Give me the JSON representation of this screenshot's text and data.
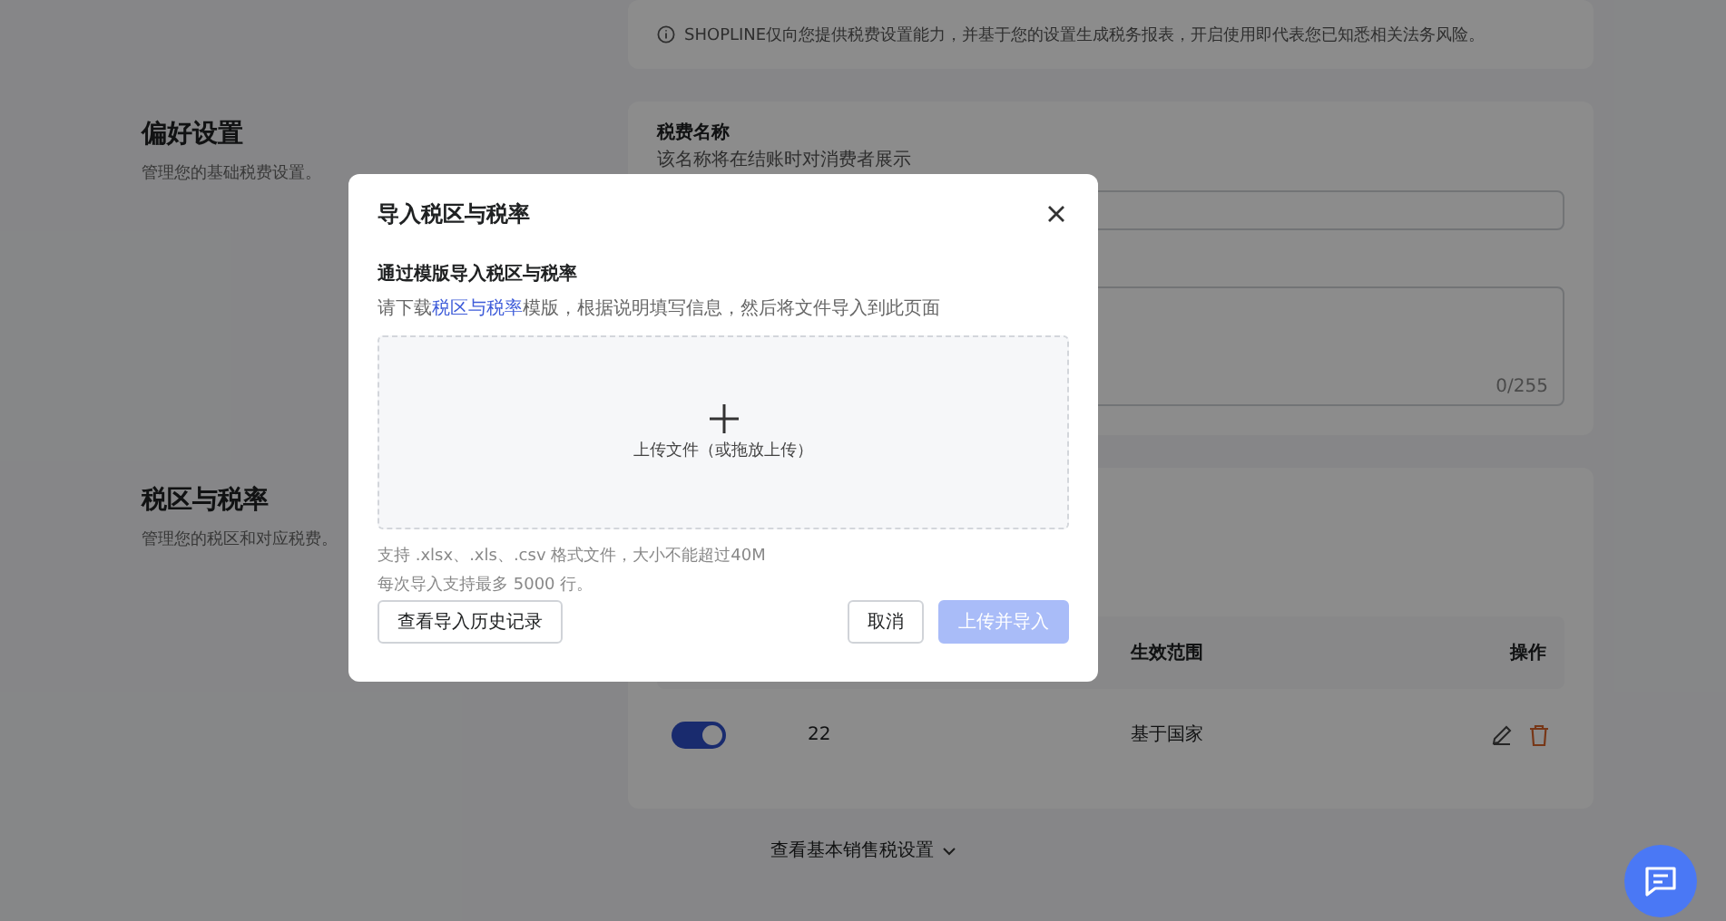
{
  "notice": {
    "text": "SHOPLINE仅向您提供税费设置能力，并基于您的设置生成税务报表，开启使用即代表您已知悉相关法务风险。"
  },
  "sections": [
    {
      "title": "偏好设置",
      "description": "管理您的基础税费设置。"
    },
    {
      "title": "税区与税率",
      "description": "管理您的税区和对应税费。"
    }
  ],
  "tax_name_field": {
    "label": "税费名称",
    "hint": "该名称将在结账时对消费者展示"
  },
  "textarea": {
    "counter": "0/255"
  },
  "table": {
    "columns": [
      "生效范围",
      "操作"
    ],
    "rows": [
      {
        "enabled": true,
        "column_2": "22",
        "scope": "基于国家"
      }
    ]
  },
  "footer_link": "查看基本销售税设置",
  "dialog": {
    "title": "导入税区与税率",
    "subtitle": "通过模版导入税区与税率",
    "instructions": {
      "before": "请下载",
      "link": "税区与税率",
      "after": "模版，根据说明填写信息，然后将文件导入到此页面"
    },
    "upload_area": {
      "label": "上传文件（或拖放上传）"
    },
    "hints": [
      "支持 .xlsx、.xls、.csv 格式文件，大小不能超过40M",
      "每次导入支持最多 5000 行。"
    ],
    "history_button": "查看导入历史记录",
    "cancel_button": "取消",
    "submit_button": {
      "label": "上传并导入",
      "disabled": true
    }
  }
}
